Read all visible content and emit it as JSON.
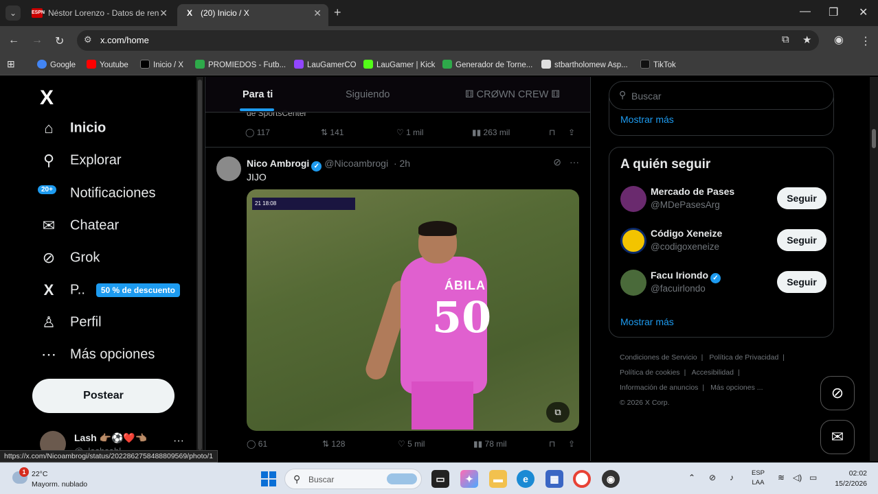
{
  "browser": {
    "tabs": [
      {
        "title": "Néstor Lorenzo - Datos de ren",
        "favicon": "ESPN"
      },
      {
        "title": "(20) Inicio / X",
        "favicon": "X"
      }
    ],
    "url": "x.com/home",
    "bookmarks": [
      {
        "label": "Google",
        "color": "#4285f4"
      },
      {
        "label": "Youtube",
        "color": "#ff0000"
      },
      {
        "label": "Inicio / X",
        "color": "#000000"
      },
      {
        "label": "PROMIEDOS - Futb...",
        "color": "#2eaa4a"
      },
      {
        "label": "LauGamerCO",
        "color": "#9146ff"
      },
      {
        "label": "LauGamer | Kick",
        "color": "#53fc18"
      },
      {
        "label": "Generador de Torne...",
        "color": "#2eaa4a"
      },
      {
        "label": "stbartholomew Asp...",
        "color": "#e0e0e0"
      },
      {
        "label": "TikTok",
        "color": "#111111"
      }
    ],
    "status_link": "https://x.com/Nicoambrogi/status/2022862758488809569/photo/1"
  },
  "sidebar": {
    "logo": "X",
    "notif_badge": "20+",
    "items": [
      {
        "label": "Inicio",
        "icon": "home-icon",
        "glyph": "⌂"
      },
      {
        "label": "Explorar",
        "icon": "search-icon",
        "glyph": "⚲"
      },
      {
        "label": "Notificaciones",
        "icon": "bell-icon",
        "glyph": "🔔"
      },
      {
        "label": "Chatear",
        "icon": "mail-icon",
        "glyph": "✉"
      },
      {
        "label": "Grok",
        "icon": "grok-icon",
        "glyph": "⊘"
      },
      {
        "label": "P..",
        "icon": "premium-x-icon",
        "glyph": "X"
      },
      {
        "label": "Perfil",
        "icon": "person-icon",
        "glyph": "♙"
      },
      {
        "label": "Más opciones",
        "icon": "more-icon",
        "glyph": "⋯"
      }
    ],
    "premium_promo": "50 % de descuento",
    "post_button": "Postear",
    "account": {
      "name": "Lash 👉🏽⚽❤️👈🏽",
      "handle": "@_lashsahl",
      "more": "···"
    }
  },
  "feed": {
    "tabs": [
      "Para ti",
      "Siguiendo",
      "⚅ CRØWN CREW ⚅"
    ],
    "prev_post": {
      "snippet": "de SportsCenter",
      "replies": "117",
      "reposts": "141",
      "likes": "1 mil",
      "views": "263 mil"
    },
    "post": {
      "name": "Nico Ambrogi",
      "handle": "@Nicoambrogi",
      "time": "· 2h",
      "text": "JIJO",
      "scorebug": "21 18:08",
      "jersey_name": "ÁBILA",
      "jersey_number": "50",
      "replies": "61",
      "reposts": "128",
      "likes": "5 mil",
      "views": "78 mil"
    }
  },
  "right": {
    "search_placeholder": "Buscar",
    "show_more_1": "Mostrar más",
    "who_to_follow_title": "A quién seguir",
    "follow": [
      {
        "name": "Mercado de Pases",
        "handle": "@MDePasesArg",
        "verified": false,
        "avatar_color": "#6a2a6e"
      },
      {
        "name": "Código Xeneize",
        "handle": "@codigoxeneize",
        "verified": false,
        "avatar_color": "#f3c400"
      },
      {
        "name": "Facu Iriondo",
        "handle": "@facuirlondo",
        "verified": true,
        "avatar_color": "#4a6a3a"
      }
    ],
    "follow_button": "Seguir",
    "show_more_2": "Mostrar más",
    "footer": [
      "Condiciones de Servicio",
      "|",
      "Política de Privacidad",
      "|",
      "Política de cookies",
      "|",
      "Accesibilidad",
      "|",
      "Información de anuncios",
      "|",
      "Más opciones ...",
      "© 2026 X Corp."
    ]
  },
  "taskbar": {
    "weather_temp": "22°C",
    "weather_desc": "Mayorm. nublado",
    "weather_badge": "1",
    "search_placeholder": "Buscar",
    "lang_1": "ESP",
    "lang_2": "LAA",
    "time": "02:02",
    "date": "15/2/2026"
  }
}
